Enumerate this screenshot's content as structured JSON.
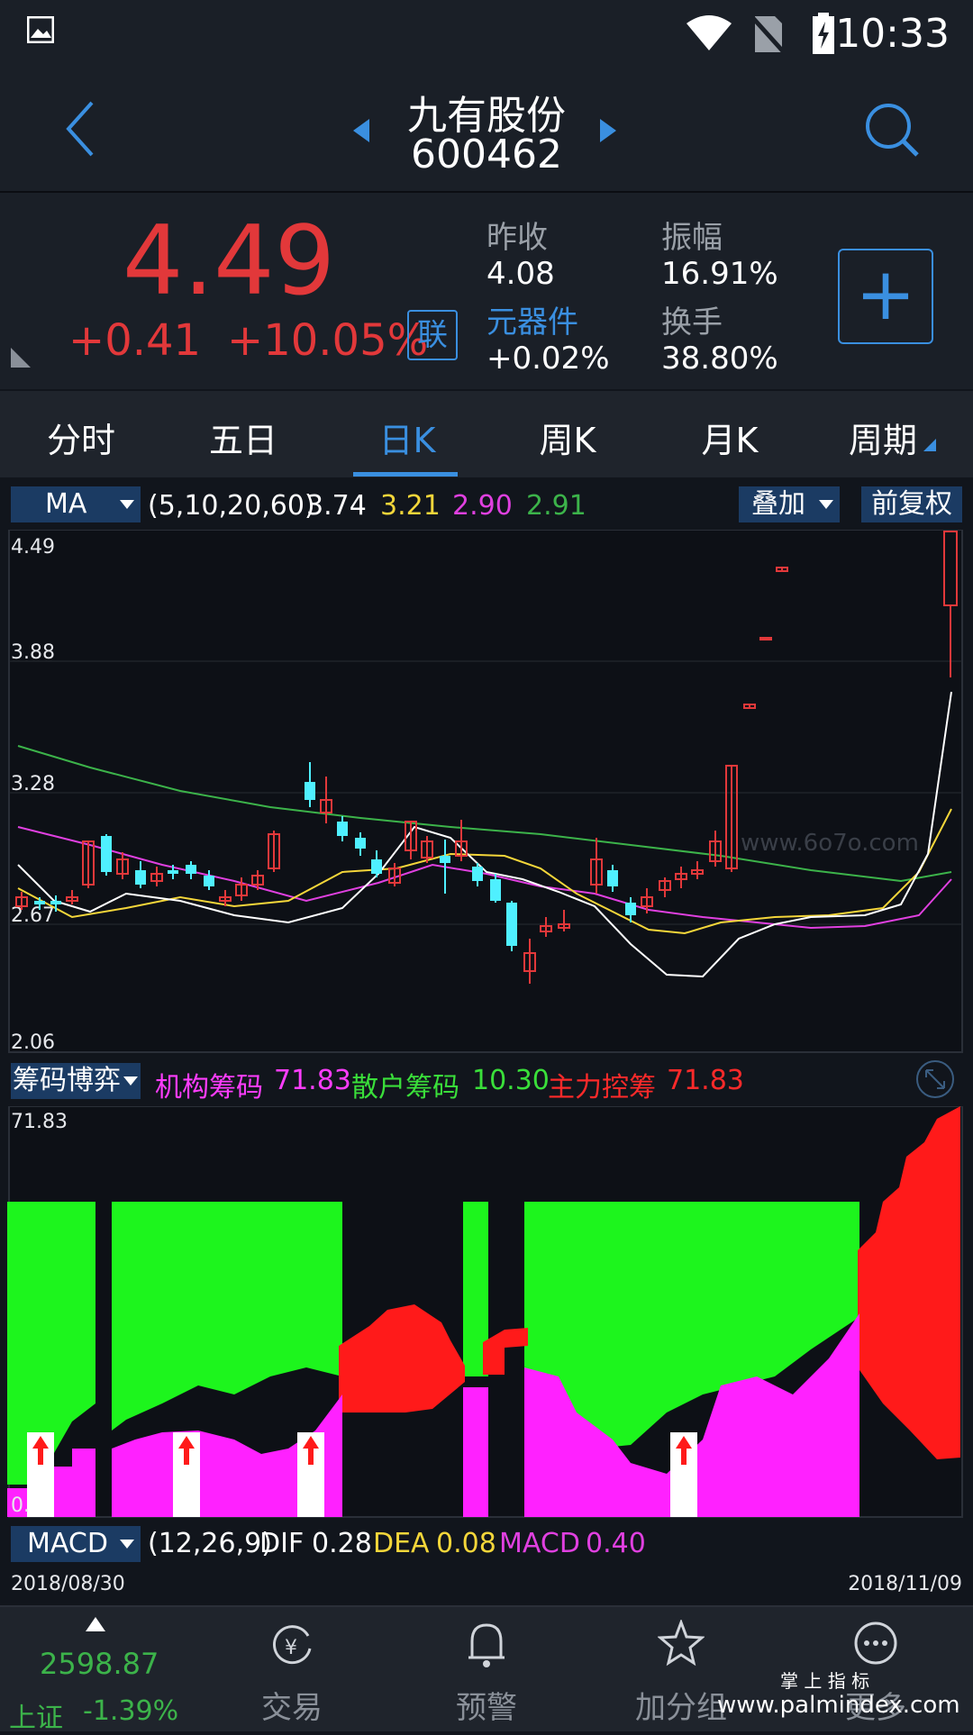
{
  "status_bar": {
    "time": "10:33"
  },
  "header": {
    "name": "九有股份",
    "code": "600462"
  },
  "quote": {
    "price": "4.49",
    "change": "+0.41",
    "change_pct": "+10.05%",
    "link_badge": "联",
    "prev_close_label": "昨收",
    "prev_close_value": "4.08",
    "amplitude_label": "振幅",
    "amplitude_value": "16.91%",
    "sector_label": "元器件",
    "sector_value": "+0.02%",
    "turnover_label": "换手",
    "turnover_value": "38.80%",
    "add_button": "+"
  },
  "tabs": [
    {
      "label": "分时",
      "active": false
    },
    {
      "label": "五日",
      "active": false
    },
    {
      "label": "日K",
      "active": true
    },
    {
      "label": "周K",
      "active": false
    },
    {
      "label": "月K",
      "active": false
    },
    {
      "label": "周期",
      "active": false
    }
  ],
  "kchart": {
    "indicator": "MA",
    "params": "(5,10,20,60)",
    "ma_values": [
      {
        "value": "3.74",
        "color": "#ffffff"
      },
      {
        "value": "3.21",
        "color": "#f4d63a"
      },
      {
        "value": "2.90",
        "color": "#e040e0"
      },
      {
        "value": "2.91",
        "color": "#3cb34a"
      }
    ],
    "overlay_label": "叠加",
    "adjust_label": "前复权",
    "y_labels": [
      "4.49",
      "3.88",
      "3.28",
      "2.67",
      "2.06"
    ],
    "watermark": "www.6o7o.com"
  },
  "chip_panel": {
    "indicator": "筹码博弈",
    "items": [
      {
        "label": "机构筹码",
        "value": "71.83",
        "color": "#ff3dff"
      },
      {
        "label": "散户筹码",
        "value": "10.30",
        "color": "#3adf3a"
      },
      {
        "label": "主力控筹",
        "value": "71.83",
        "color": "#ff2a2a"
      }
    ],
    "y_top": "71.83",
    "y_bottom": "0."
  },
  "macd": {
    "indicator": "MACD",
    "params": "(12,26,9)",
    "items": [
      {
        "label": "DIF",
        "value": "0.28",
        "color": "#ffffff"
      },
      {
        "label": "DEA",
        "value": "0.08",
        "color": "#f4d63a"
      },
      {
        "label": "MACD",
        "value": "0.40",
        "color": "#e040e0"
      }
    ]
  },
  "dates": {
    "start": "2018/08/30",
    "end": "2018/11/09"
  },
  "bottom_nav": {
    "index_value": "2598.87",
    "index_name": "上证",
    "index_change": "-1.39%",
    "items": [
      {
        "label": "交易",
        "icon": "yen-exchange-icon"
      },
      {
        "label": "预警",
        "icon": "bell-icon"
      },
      {
        "label": "加分组",
        "icon": "star-icon"
      },
      {
        "label": "更多",
        "icon": "more-icon"
      }
    ],
    "watermark_top": "掌 上 指 标",
    "watermark_url": "www.palmindex.com"
  }
}
